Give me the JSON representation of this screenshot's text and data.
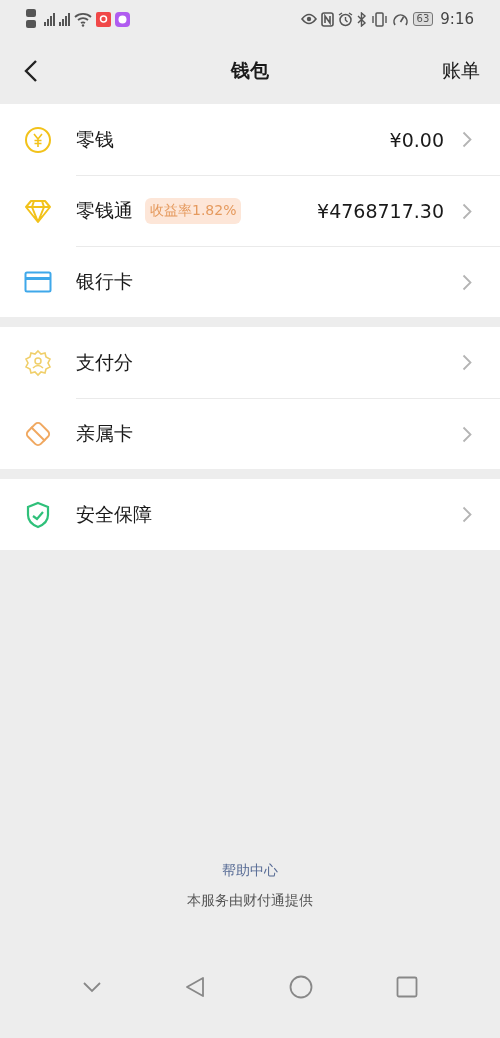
{
  "status_bar": {
    "time": "9:16",
    "battery": "63"
  },
  "nav": {
    "title": "钱包",
    "action": "账单"
  },
  "groups": [
    {
      "items": [
        {
          "kind": "coin",
          "label": "零钱",
          "value": "¥0.00"
        },
        {
          "kind": "diamond",
          "label": "零钱通",
          "badge": "收益率1.82%",
          "value": "¥4768717.30"
        },
        {
          "kind": "card",
          "label": "银行卡"
        }
      ]
    },
    {
      "items": [
        {
          "kind": "score",
          "label": "支付分"
        },
        {
          "kind": "family",
          "label": "亲属卡"
        }
      ]
    },
    {
      "items": [
        {
          "kind": "shield",
          "label": "安全保障"
        }
      ]
    }
  ],
  "footer": {
    "link": "帮助中心",
    "note": "本服务由财付通提供"
  }
}
